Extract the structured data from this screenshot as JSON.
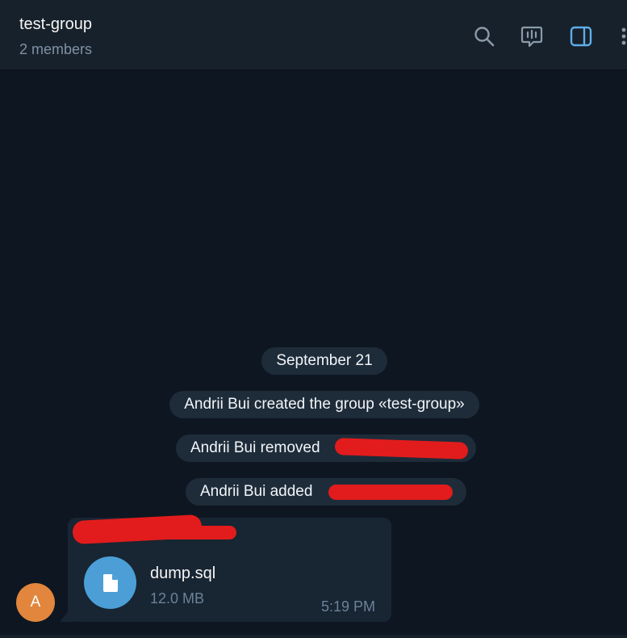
{
  "header": {
    "title": "test-group",
    "subtitle": "2 members",
    "icons": [
      "search-icon",
      "live-chat-icon",
      "sidebar-toggle-icon",
      "more-vertical-icon"
    ],
    "accent": "#5eaee8"
  },
  "chat": {
    "date_label": "September 21",
    "service_messages": [
      "Andrii Bui created the group «test-group»",
      "Andrii Bui removed",
      "Andrii Bui added"
    ],
    "message": {
      "avatar_initial": "A",
      "avatar_color": "#e1863c",
      "file": {
        "name": "dump.sql",
        "size": "12.0 MB",
        "icon": "document-icon"
      },
      "time": "5:19 PM"
    }
  }
}
